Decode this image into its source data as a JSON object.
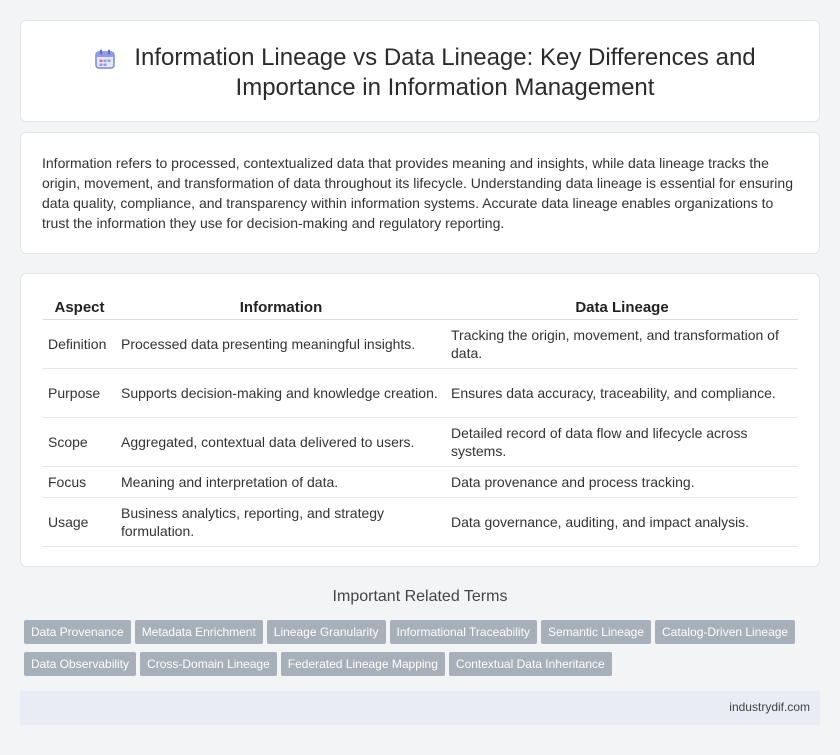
{
  "header": {
    "title": "Information Lineage vs Data Lineage: Key Differences and Importance in Information Management",
    "icon": "calendar-icon"
  },
  "intro": {
    "text": "Information refers to processed, contextualized data that provides meaning and insights, while data lineage tracks the origin, movement, and transformation of data throughout its lifecycle. Understanding data lineage is essential for ensuring data quality, compliance, and transparency within information systems. Accurate data lineage enables organizations to trust the information they use for decision-making and regulatory reporting."
  },
  "table": {
    "headers": [
      "Aspect",
      "Information",
      "Data Lineage"
    ],
    "rows": [
      [
        "Definition",
        "Processed data presenting meaningful insights.",
        "Tracking the origin, movement, and transformation of data."
      ],
      [
        "Purpose",
        "Supports decision-making and knowledge creation.",
        "Ensures data accuracy, traceability, and compliance."
      ],
      [
        "Scope",
        "Aggregated, contextual data delivered to users.",
        "Detailed record of data flow and lifecycle across systems."
      ],
      [
        "Focus",
        "Meaning and interpretation of data.",
        "Data provenance and process tracking."
      ],
      [
        "Usage",
        "Business analytics, reporting, and strategy formulation.",
        "Data governance, auditing, and impact analysis."
      ]
    ]
  },
  "related": {
    "title": "Important Related Terms",
    "row1": [
      "Data Provenance",
      "Metadata Enrichment",
      "Lineage Granularity",
      "Informational Traceability",
      "Semantic Lineage",
      "Catalog-Driven Lineage"
    ],
    "row2": [
      "Data Observability",
      "Cross-Domain Lineage",
      "Federated Lineage Mapping",
      "Contextual Data Inheritance"
    ]
  },
  "footer": {
    "site": "industrydif.com"
  },
  "colors": {
    "tag_bg": "#a7afb9",
    "footer_bg": "#e9ecf4",
    "icon_accent": "#6f7fd9"
  }
}
